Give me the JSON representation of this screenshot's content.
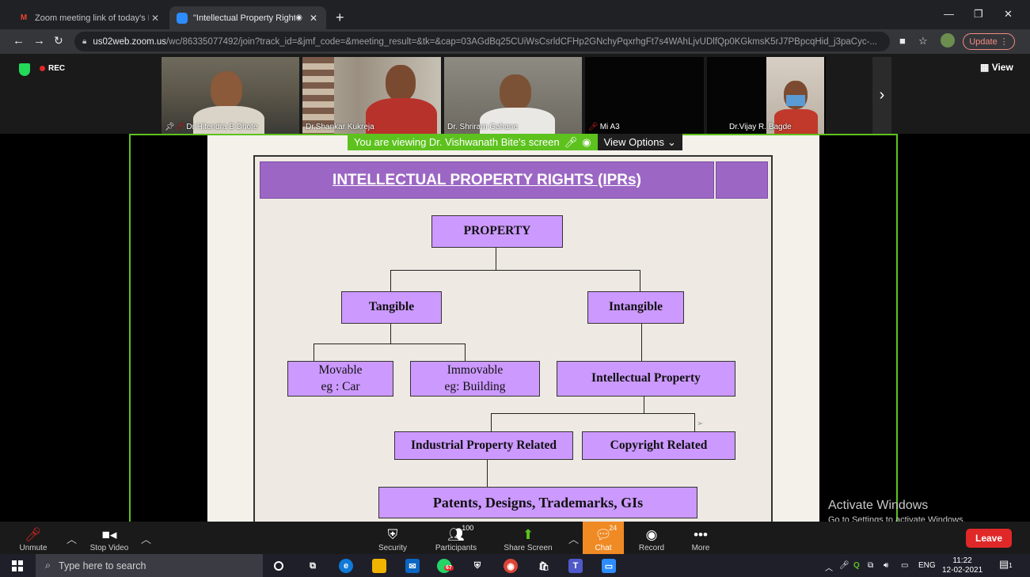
{
  "browser": {
    "tabs": [
      {
        "title": "Zoom meeting link of today's Na",
        "icon": "gmail-icon"
      },
      {
        "title": "\"Intellectual Property Rights.",
        "icon": "zoom-icon"
      }
    ],
    "url_host": "us02web.zoom.us",
    "url_rest": "/wc/86335077492/join?track_id=&jmf_code=&meeting_result=&tk=&cap=03AGdBq25CUiWsCsrldCFHp2GNchyPqxrhgFt7s4WAhLjvUDlfQp0KGkmsK5rJ7PBpcqHid_j3paCyc-...",
    "update_label": "Update"
  },
  "meeting": {
    "rec_label": "REC",
    "view_label": "View",
    "participants": [
      {
        "name": "Dr Hitendra B Dhote",
        "muted": true,
        "pinned": true
      },
      {
        "name": "Dr.Shankar Kukreja",
        "muted": false
      },
      {
        "name": "Dr. Shriram Gahane",
        "muted": false
      },
      {
        "name": "Mi A3",
        "muted": true
      },
      {
        "name": "Dr.Vijay R. Bagde",
        "muted": false
      }
    ],
    "viewing_message": "You are viewing Dr. Vishwanath Bite's screen",
    "view_options_label": "View Options"
  },
  "slide": {
    "title": "INTELLECTUAL PROPERTY RIGHTS (IPRs)",
    "nodes": {
      "property": "PROPERTY",
      "tangible": "Tangible",
      "intangible": "Intangible",
      "movable_1": "Movable",
      "movable_2": "eg : Car",
      "immovable_1": "Immovable",
      "immovable_2": "eg: Building",
      "intellectual": "Intellectual Property",
      "industrial": "Industrial Property Related",
      "copyright": "Copyright Related",
      "patents": "Patents, Designs, Trademarks, GIs"
    }
  },
  "watermark": {
    "line1": "Activate Windows",
    "line2": "Go to Settings to activate Windows."
  },
  "controls": {
    "unmute": "Unmute",
    "stop_video": "Stop Video",
    "security": "Security",
    "participants": "Participants",
    "participants_count": "100",
    "share_screen": "Share Screen",
    "chat": "Chat",
    "chat_count": "24",
    "record": "Record",
    "more": "More",
    "leave": "Leave"
  },
  "taskbar": {
    "search_placeholder": "Type here to search",
    "whatsapp_badge": "67",
    "language": "ENG",
    "time": "11:22",
    "date": "12-02-2021",
    "notification_count": "1"
  }
}
